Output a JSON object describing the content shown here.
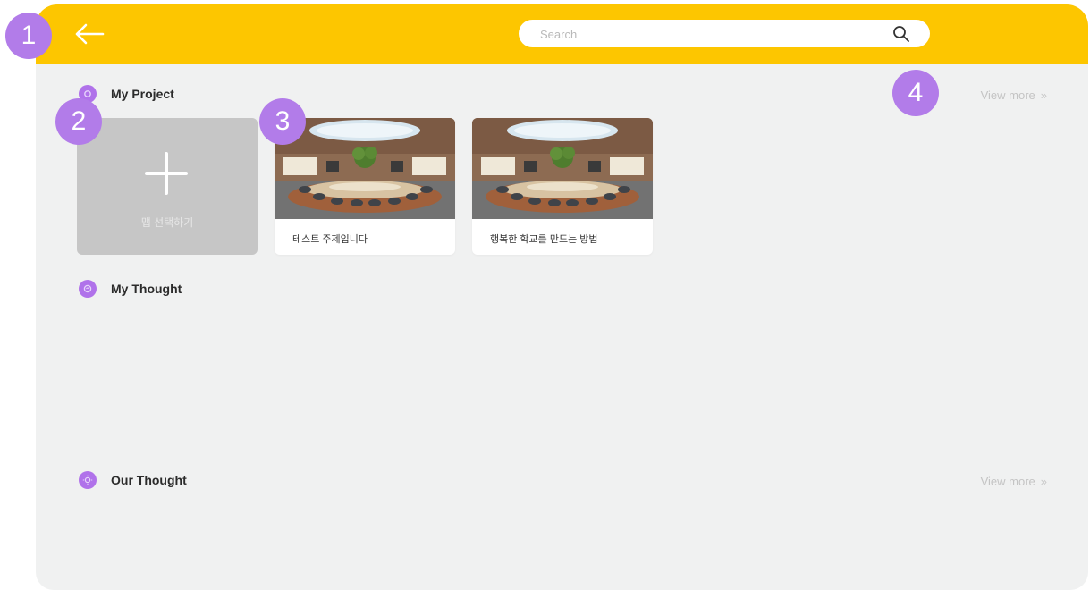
{
  "header": {
    "search_placeholder": "Search"
  },
  "sections": {
    "my_project": {
      "title": "My Project",
      "view_more": "View more"
    },
    "my_thought": {
      "title": "My Thought"
    },
    "our_thought": {
      "title": "Our Thought",
      "view_more": "View more"
    }
  },
  "add_card": {
    "label": "맵 선택하기"
  },
  "projects": [
    {
      "title": "테스트 주제입니다"
    },
    {
      "title": "행복한 학교를 만드는 방법"
    }
  ],
  "callouts": [
    "1",
    "2",
    "3",
    "4"
  ],
  "colors": {
    "header": "#fdc600",
    "accent_purple": "#b27ce9",
    "panel_bg": "#f0f1f1"
  },
  "icons": {
    "back": "arrow-left-icon",
    "search": "search-icon",
    "section": "purple-circle-icon",
    "add": "plus-icon",
    "view_more": "double-chevron-right-icon"
  }
}
